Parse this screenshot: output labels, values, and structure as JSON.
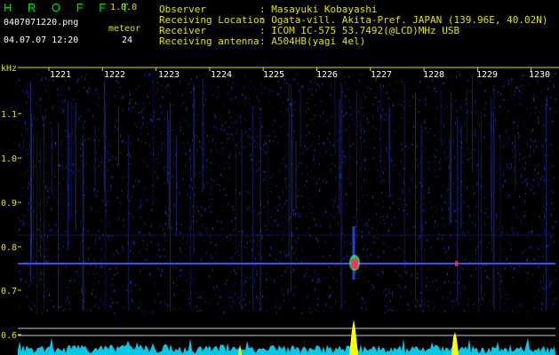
{
  "app": {
    "title": "H R O F F T",
    "version": "1.0.0"
  },
  "file": {
    "name": "0407071220.png",
    "timestamp": "04.07.07 12:20"
  },
  "meteor": {
    "label": "meteor",
    "count": "24"
  },
  "info": [
    {
      "label": "Observer",
      "value": ": Masayuki Kobayashi"
    },
    {
      "label": "Receiving Location",
      "value": ": Ogata-vill. Akita-Pref. JAPAN (139.96E, 40.02N)"
    },
    {
      "label": "Receiver",
      "value": ": ICOM IC-575 53.7492(@LCD)MHz USB"
    },
    {
      "label": "Receiving antenna",
      "value": ": A504HB(yagi 4el)"
    }
  ],
  "axis": {
    "y_unit": "kHz",
    "y_ticks": [
      "1.1",
      "1.0",
      "0.9",
      "0.8",
      "0.7",
      "0.6"
    ],
    "x_ticks": [
      "1221",
      "1222",
      "1223",
      "1224",
      "1225",
      "1226",
      "1227",
      "1228",
      "1229",
      "1230"
    ]
  },
  "colors": {
    "label_yellow": "#e0e000",
    "title_green": "#00e000",
    "spectrogram_blue": "#2a3ad8",
    "carrier_line": "#3050ff",
    "meteor_hot": "#ff3060",
    "meteor_warm": "#40ff80",
    "power_trace": "#00e0ff",
    "meteor_peak": "#ffff00"
  }
}
